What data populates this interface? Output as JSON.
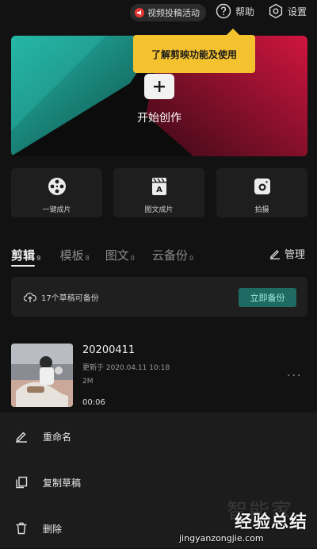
{
  "topbar": {
    "promo_label": "视频投稿活动",
    "help_label": "帮助",
    "settings_label": "设置"
  },
  "tooltip": {
    "text": "了解剪映功能及使用"
  },
  "hero": {
    "start_label": "开始创作"
  },
  "features": [
    {
      "label": "一键成片",
      "icon": "film-reel-icon"
    },
    {
      "label": "图文成片",
      "icon": "document-clap-icon"
    },
    {
      "label": "拍摄",
      "icon": "camera-icon"
    }
  ],
  "tabs": [
    {
      "label": "剪辑",
      "count": "9"
    },
    {
      "label": "模板",
      "count": "8"
    },
    {
      "label": "图文",
      "count": "0"
    },
    {
      "label": "云备份",
      "count": "0"
    }
  ],
  "manage_label": "管理",
  "backup": {
    "text": "17个草稿可备份",
    "button": "立即备份"
  },
  "draft": {
    "title": "20200411",
    "updated": "更新于 2020.04.11 10:18",
    "size": "2M",
    "duration": "00:06",
    "more": "···"
  },
  "sheet": {
    "items": [
      {
        "label": "重命名",
        "icon": "pencil-icon"
      },
      {
        "label": "复制草稿",
        "icon": "copy-icon"
      },
      {
        "label": "删除",
        "icon": "trash-icon"
      }
    ]
  },
  "watermark": {
    "faint": "智能家",
    "brand": "经验总结",
    "url": "jingyanzongjie.com"
  },
  "colors": {
    "accent_yellow": "#f5c22f",
    "backup_button": "#1f6b64",
    "hero_teal": "#1fa89a",
    "hero_red": "#c0143c"
  }
}
